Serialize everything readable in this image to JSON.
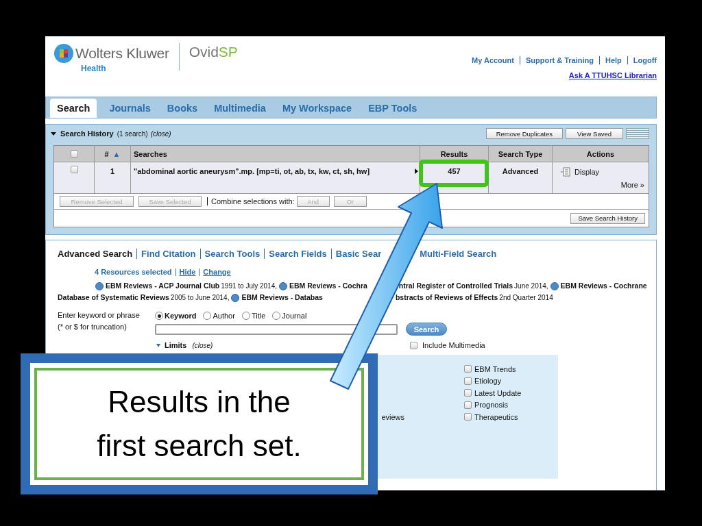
{
  "header": {
    "brand": "Wolters Kluwer",
    "brand_sub": "Health",
    "product": "Ovid",
    "product_suffix": "SP",
    "links": [
      "My Account",
      "Support & Training",
      "Help",
      "Logoff"
    ],
    "librarian_link": "Ask A TTUHSC Librarian"
  },
  "tabs": [
    {
      "label": "Search",
      "selected": true
    },
    {
      "label": "Journals",
      "selected": false
    },
    {
      "label": "Books",
      "selected": false
    },
    {
      "label": "Multimedia",
      "selected": false
    },
    {
      "label": "My Workspace",
      "selected": false
    },
    {
      "label": "EBP Tools",
      "selected": false
    }
  ],
  "search_history": {
    "title": "Search History",
    "count": "(1 search)",
    "close": "(close)",
    "expanded": true,
    "buttons": [
      "Remove Duplicates",
      "View Saved"
    ],
    "header_checked": false,
    "columns": [
      {
        "label": "#",
        "sort": "▲"
      },
      {
        "label": "Searches"
      },
      {
        "label": "Results"
      },
      {
        "label": "Search Type"
      },
      {
        "label": "Actions"
      }
    ],
    "rows": [
      {
        "checked": false,
        "number": "1",
        "search": "\"abdominal aortic aneurysm\".mp. [mp=ti, ot, ab, tx, kw, ct, sh, hw]",
        "results": "457",
        "search_type": "Advanced",
        "action": "Display",
        "more": "More »"
      }
    ],
    "selection_buttons": [
      {
        "label": "Remove Selected",
        "disabled": true
      },
      {
        "label": "Save Selected",
        "disabled": true
      }
    ],
    "combine_label": "Combine selections with:",
    "combine_buttons": [
      {
        "label": "And",
        "disabled": true
      },
      {
        "label": "Or",
        "disabled": true
      }
    ],
    "save_button": "Save Search History"
  },
  "advanced_search": {
    "nav": [
      {
        "label": "Advanced Search",
        "selected": true,
        "obscured_before": false
      },
      {
        "label": "Find Citation",
        "selected": false,
        "obscured_before": false
      },
      {
        "label": "Search Tools",
        "selected": false,
        "obscured_before": false
      },
      {
        "label": "Search Fields",
        "selected": false,
        "obscured_before": false
      },
      {
        "label": "Basic Sear",
        "selected": false,
        "obscured_before": false
      },
      {
        "label": "Multi-Field Search",
        "selected": false,
        "obscured_before": true
      }
    ],
    "resources": {
      "count": "4 Resources selected",
      "hide": "Hide",
      "change": "Change"
    },
    "databases": [
      {
        "kind": "info"
      },
      {
        "kind": "name",
        "text": "EBM Reviews - ACP Journal Club"
      },
      {
        "kind": "range",
        "text": "1991 to July 2014,"
      },
      {
        "kind": "info"
      },
      {
        "kind": "name",
        "text": "EBM Reviews - Cochra"
      },
      {
        "kind": "gap"
      },
      {
        "kind": "name",
        "text": "ntral Register of Controlled Trials"
      },
      {
        "kind": "range",
        "text": "June 2014,"
      },
      {
        "kind": "info"
      },
      {
        "kind": "name",
        "text": "EBM Reviews - Cochrane"
      },
      {
        "kind": "break"
      },
      {
        "kind": "name",
        "text": "Database of Systematic Reviews"
      },
      {
        "kind": "range",
        "text": "2005 to June 2014,"
      },
      {
        "kind": "info"
      },
      {
        "kind": "name",
        "text": "EBM Reviews - Databas"
      },
      {
        "kind": "gap"
      },
      {
        "kind": "name",
        "text": "bstracts of Reviews of Effects"
      },
      {
        "kind": "range",
        "text": "2nd Quarter 2014"
      }
    ],
    "prompt": "Enter keyword or phrase",
    "hint": "(* or $ for truncation)",
    "fields": [
      {
        "label": "Keyword",
        "selected": true
      },
      {
        "label": "Author",
        "selected": false
      },
      {
        "label": "Title",
        "selected": false
      },
      {
        "label": "Journal",
        "selected": false
      }
    ],
    "search_button": "Search",
    "limits": {
      "title": "Limits",
      "close": "(close)",
      "expanded": true,
      "left_fragment": "eviews",
      "options": [
        {
          "label": "EBM Trends",
          "checked": false
        },
        {
          "label": "Etiology",
          "checked": false
        },
        {
          "label": "Latest Update",
          "checked": false
        },
        {
          "label": "Prognosis",
          "checked": false
        },
        {
          "label": "Therapeutics",
          "checked": false
        }
      ]
    },
    "multimedia": {
      "label": "Include Multimedia",
      "checked": false
    }
  },
  "callout": {
    "text": "Results in the first search set."
  }
}
